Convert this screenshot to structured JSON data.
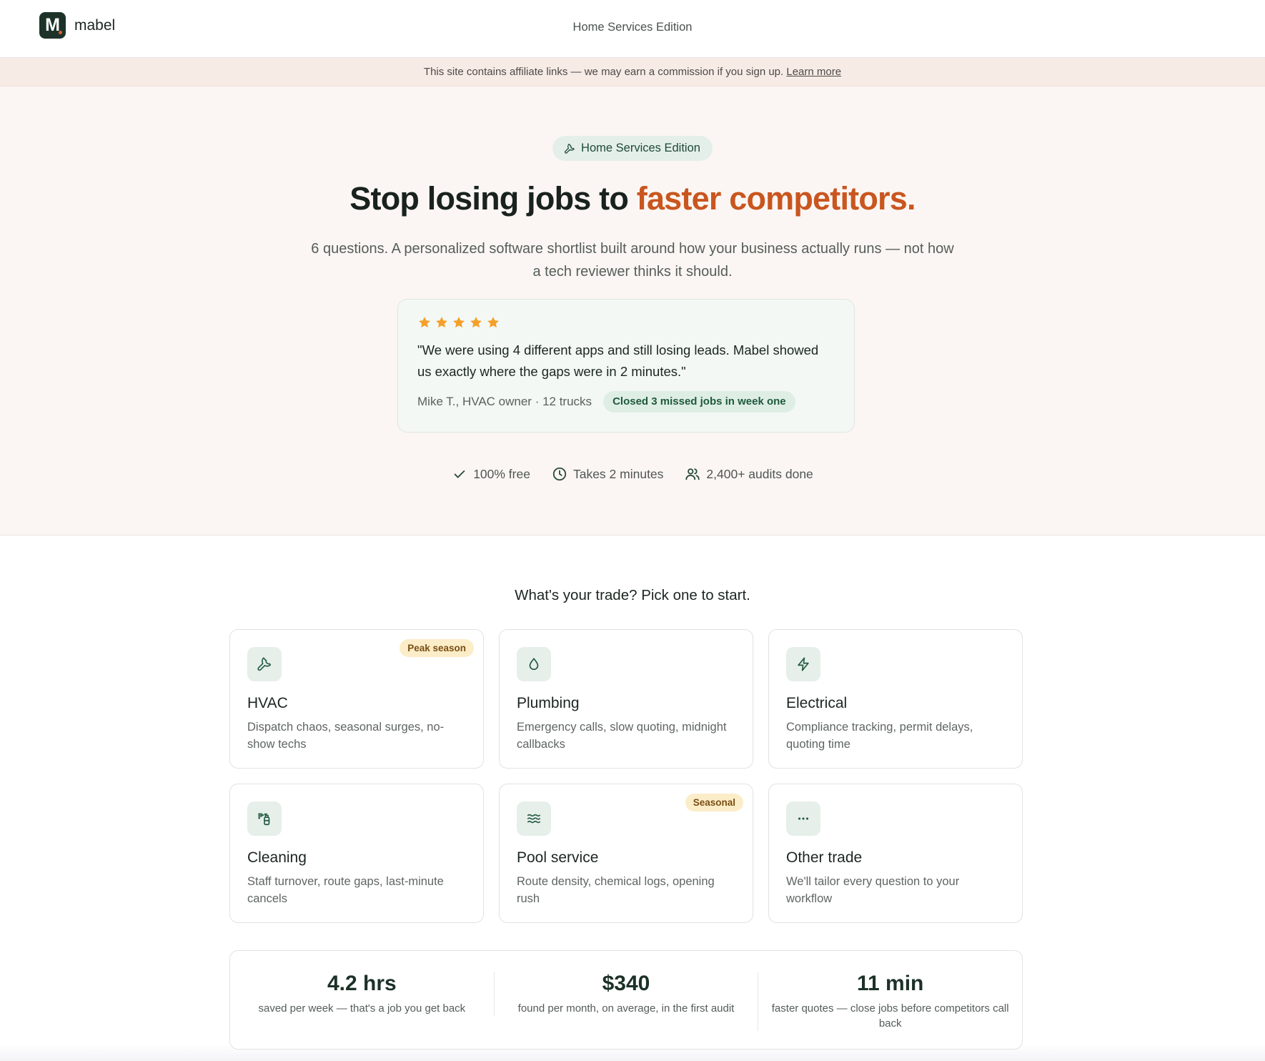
{
  "header": {
    "brand": "mabel",
    "logo_letter": "M",
    "edition": "Home Services Edition"
  },
  "banner": {
    "text": "This site contains affiliate links — we may earn a commission if you sign up.",
    "link": "Learn more"
  },
  "hero": {
    "pill": "Home Services Edition",
    "title_start": "Stop losing jobs to ",
    "title_accent": "faster competitors.",
    "subtitle": "6 questions. A personalized software shortlist built around how your business actually runs — not how a tech reviewer thinks it should.",
    "testimonial": {
      "stars": 5,
      "quote": "\"We were using 4 different apps and still losing leads. Mabel showed us exactly where the gaps were in 2 minutes.\"",
      "author": "Mike T., HVAC owner · 12 trucks",
      "result": "Closed 3 missed jobs in week one"
    },
    "trust": [
      {
        "icon": "check-icon",
        "text": "100% free"
      },
      {
        "icon": "clock-icon",
        "text": "Takes 2 minutes"
      },
      {
        "icon": "users-icon",
        "text": "2,400+ audits done"
      }
    ]
  },
  "picker": {
    "title": "What's your trade? Pick one to start.",
    "trades": [
      {
        "icon": "wrench-icon",
        "name": "HVAC",
        "desc": "Dispatch chaos, seasonal surges, no-show techs",
        "tag": "Peak season"
      },
      {
        "icon": "droplet-icon",
        "name": "Plumbing",
        "desc": "Emergency calls, slow quoting, midnight callbacks",
        "tag": ""
      },
      {
        "icon": "bolt-icon",
        "name": "Electrical",
        "desc": "Compliance tracking, permit delays, quoting time",
        "tag": ""
      },
      {
        "icon": "spray-bottle-icon",
        "name": "Cleaning",
        "desc": "Staff turnover, route gaps, last-minute cancels",
        "tag": ""
      },
      {
        "icon": "waves-icon",
        "name": "Pool service",
        "desc": "Route density, chemical logs, opening rush",
        "tag": "Seasonal"
      },
      {
        "icon": "more-icon",
        "name": "Other trade",
        "desc": "We'll tailor every question to your workflow",
        "tag": ""
      }
    ]
  },
  "stats": [
    {
      "value": "4.2 hrs",
      "caption": "saved per week — that's a job you get back"
    },
    {
      "value": "$340",
      "caption": "found per month, on average, in the first audit"
    },
    {
      "value": "11 min",
      "caption": "faster quotes — close jobs before competitors call back"
    }
  ],
  "colors": {
    "accent": "#c9561f",
    "brand_dark": "#1d3329",
    "star": "#f5a02a",
    "badge_green_bg": "#dfeee5",
    "tag_bg": "#fcedc9"
  }
}
